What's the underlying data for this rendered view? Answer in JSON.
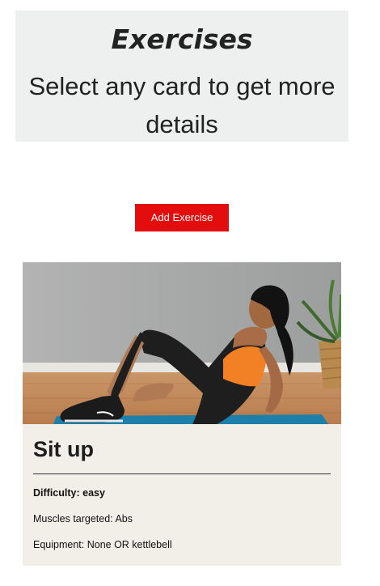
{
  "header": {
    "title": "Exercises",
    "subtitle": "Select any card to get more details"
  },
  "add_button": {
    "label": "Add Exercise"
  },
  "exercises": [
    {
      "image_alt_icon": "woman-doing-sit-up-photo",
      "title": "Sit up",
      "difficulty_label": "Difficulty:",
      "difficulty_value": "easy",
      "muscles_label": "Muscles targeted:",
      "muscles_value": "Abs",
      "equipment_label": "Equipment:",
      "equipment_value": "None OR kettlebell"
    }
  ],
  "colors": {
    "header_bg": "#eeefef",
    "button_bg": "#e30d0d",
    "card_bg": "#f2efe8"
  }
}
